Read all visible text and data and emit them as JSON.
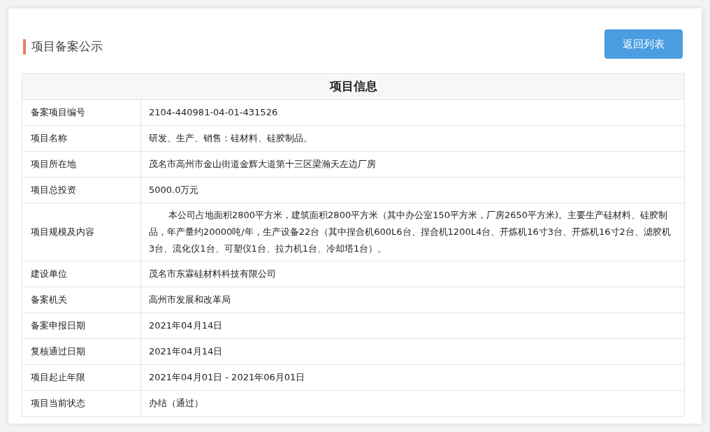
{
  "page": {
    "title": "项目备案公示",
    "back_button": "返回列表"
  },
  "table": {
    "heading": "项目信息",
    "rows": [
      {
        "kind": "line",
        "label": "备案项目编号",
        "value": "2104-440981-04-01-431526"
      },
      {
        "kind": "line",
        "label": "项目名称",
        "value": "研发、生产、销售：硅材料、硅胶制品。"
      },
      {
        "kind": "line",
        "label": "项目所在地",
        "value": "茂名市高州市金山街道金辉大道第十三区梁瀚天左边厂房"
      },
      {
        "kind": "line",
        "label": "项目总投资",
        "value": "5000.0万元"
      },
      {
        "kind": "paragraph",
        "label": "项目规模及内容",
        "value": "本公司占地面积2800平方米，建筑面积2800平方米（其中办公室150平方米，厂房2650平方米)。主要生产硅材料、硅胶制品，年产量约20000吨/年，生产设备22台（其中捏合机600L6台、捏合机1200L4台、开炼机16寸3台、开炼机16寸2台、滤胶机3台、流化仪1台、可塑仪1台、拉力机1台、冷却塔1台）。"
      },
      {
        "kind": "line",
        "label": "建设单位",
        "value": "茂名市东霖硅材料科技有限公司"
      },
      {
        "kind": "line",
        "label": "备案机关",
        "value": "高州市发展和改革局"
      },
      {
        "kind": "line",
        "label": "备案申报日期",
        "value": "2021年04月14日"
      },
      {
        "kind": "line",
        "label": "复核通过日期",
        "value": "2021年04月14日"
      },
      {
        "kind": "line",
        "label": "项目起止年限",
        "value": "2021年04月01日 - 2021年06月01日"
      },
      {
        "kind": "line",
        "label": "项目当前状态",
        "value": "办结（通过）"
      }
    ]
  }
}
